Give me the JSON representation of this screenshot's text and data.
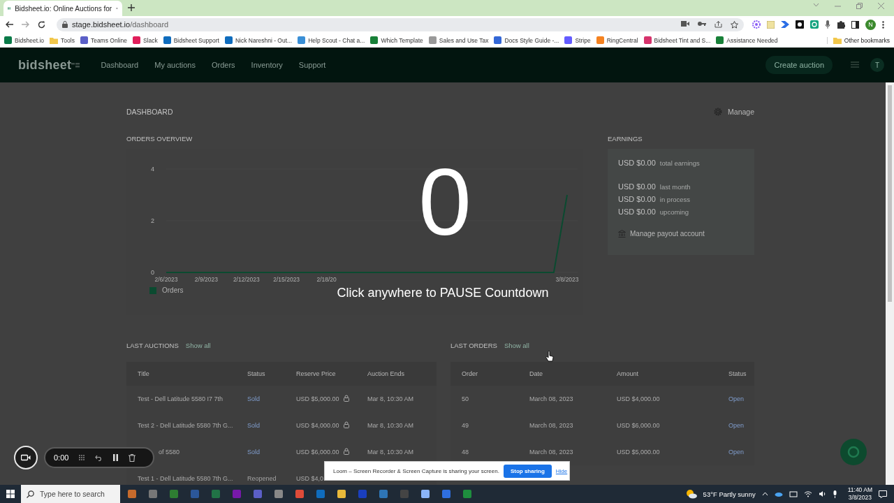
{
  "browser": {
    "tab_title": "Bidsheet.io: Online Auctions for",
    "address_host": "stage.bidsheet.io",
    "address_path": "/dashboard",
    "profile": "N",
    "bookmarks": [
      {
        "label": "Bidsheet.io",
        "kind": "link"
      },
      {
        "label": "Tools",
        "kind": "folder"
      },
      {
        "label": "Teams Online",
        "kind": "link"
      },
      {
        "label": "Slack",
        "kind": "link"
      },
      {
        "label": "Bidsheet Support",
        "kind": "link"
      },
      {
        "label": "Nick Nareshni - Out...",
        "kind": "link"
      },
      {
        "label": "Help Scout - Chat a...",
        "kind": "link"
      },
      {
        "label": "Which Template",
        "kind": "link"
      },
      {
        "label": "Sales and Use Tax",
        "kind": "link"
      },
      {
        "label": "Docs Style Guide -...",
        "kind": "link"
      },
      {
        "label": "Stripe",
        "kind": "link"
      },
      {
        "label": "RingCentral",
        "kind": "link"
      },
      {
        "label": "Bidsheet Tint and S...",
        "kind": "link"
      },
      {
        "label": "Assistance Needed",
        "kind": "link"
      }
    ],
    "other_bookmarks": "Other bookmarks"
  },
  "app": {
    "logo": "bidsheet",
    "nav": [
      "Dashboard",
      "My auctions",
      "Orders",
      "Inventory",
      "Support"
    ],
    "create_button": "Create auction",
    "avatar": "T"
  },
  "page": {
    "title": "DASHBOARD",
    "manage": "Manage"
  },
  "orders_overview": {
    "title": "ORDERS OVERVIEW",
    "chart_data": {
      "type": "line",
      "categories": [
        "2/6/2023",
        null,
        null,
        "2/9/2023",
        null,
        null,
        "2/12/2023",
        null,
        null,
        "2/15/2023",
        null,
        null,
        "2/18/20",
        null,
        null,
        null,
        null,
        null,
        null,
        null,
        null,
        null,
        null,
        null,
        null,
        null,
        null,
        null,
        null,
        null,
        "3/8/2023"
      ],
      "ylim": [
        0,
        4
      ],
      "yticks": [
        0,
        2,
        4
      ],
      "series": [
        {
          "name": "Orders",
          "color": "#0b4a30",
          "values": [
            0,
            0,
            0,
            0,
            0,
            0,
            0,
            0,
            0,
            0,
            0,
            0,
            0,
            0,
            0,
            0,
            0,
            0,
            0,
            0,
            0,
            0,
            0,
            0,
            0,
            0,
            0,
            0,
            0,
            0,
            3
          ]
        }
      ]
    }
  },
  "earnings": {
    "title": "EARNINGS",
    "total": {
      "amount": "USD $0.00",
      "note": "total earnings"
    },
    "items": [
      {
        "amount": "USD $0.00",
        "note": "last month"
      },
      {
        "amount": "USD $0.00",
        "note": "in process"
      },
      {
        "amount": "USD $0.00",
        "note": "upcoming"
      }
    ],
    "payout": "Manage payout account"
  },
  "last_auctions": {
    "title": "LAST AUCTIONS",
    "show_all": "Show all",
    "columns": [
      "Title",
      "Status",
      "Reserve Price",
      "Auction Ends"
    ],
    "rows": [
      {
        "title": "Test - Dell Latitude 5580 I7 7th",
        "status": "Sold",
        "kind": "sold",
        "reserve_price": "USD $5,000.00",
        "locked": true,
        "ends": "Mar 8, 10:30 AM"
      },
      {
        "title": "Test 2 - Dell Latitude 5580 7th G...",
        "status": "Sold",
        "kind": "sold",
        "reserve_price": "USD $4,000.00",
        "locked": true,
        "ends": "Mar 8, 10:30 AM"
      },
      {
        "title": "of 5580",
        "covered": true,
        "status": "Sold",
        "kind": "sold",
        "reserve_price": "USD $6,000.00",
        "locked": true,
        "ends": "Mar 8, 10:30 AM"
      },
      {
        "title": "Test 1 - Dell Latitude 5580 7th G...",
        "status": "Reopened",
        "kind": "reopened",
        "reserve_price": "USD $4,0"
      }
    ]
  },
  "last_orders": {
    "title": "LAST ORDERS",
    "show_all": "Show all",
    "columns": [
      "Order",
      "Date",
      "Amount",
      "Status"
    ],
    "rows": [
      {
        "order": "50",
        "date": "March 08, 2023",
        "amount": "USD $4,000.00",
        "status": "Open"
      },
      {
        "order": "49",
        "date": "March 08, 2023",
        "amount": "USD $6,000.00",
        "status": "Open"
      },
      {
        "order": "48",
        "date": "March 08, 2023",
        "amount": "USD $5,000.00",
        "status": "Open"
      }
    ]
  },
  "countdown": {
    "number": "0",
    "hint": "Click anywhere to PAUSE Countdown"
  },
  "loom_controls": {
    "time": "0:00"
  },
  "loom_bar": {
    "message": "Loom – Screen Recorder & Screen Capture is sharing your screen.",
    "stop_button": "Stop sharing",
    "hide_link": "Hide"
  },
  "taskbar": {
    "search_placeholder": "Type here to search",
    "weather": "53°F  Partly sunny",
    "time": "11:40 AM",
    "date": "3/8/2023"
  }
}
